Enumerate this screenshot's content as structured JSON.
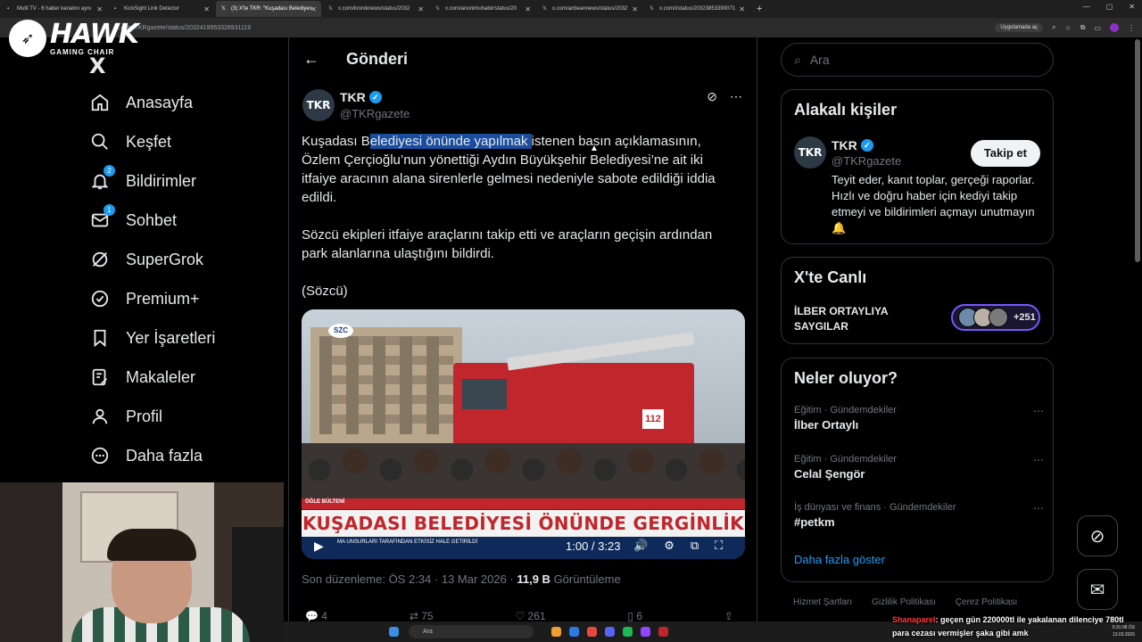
{
  "browser": {
    "tabs": [
      {
        "label": "Multi TV - 6 haber kanalını aynı",
        "active": false
      },
      {
        "label": "KickSight Link Detector",
        "active": false
      },
      {
        "label": "(3) X'te TKR: \"Kuşadası Belediyes",
        "active": true
      },
      {
        "label": "x.com/kroniknews/status/2032",
        "active": false
      },
      {
        "label": "x.com/anonimuhabir/status/20",
        "active": false
      },
      {
        "label": "x.com/anbeannews/status/2032",
        "active": false
      },
      {
        "label": "x.com/i/status/20323853390071",
        "active": false
      }
    ],
    "url": "x.com/TKRgazete/status/2032419953328931119",
    "app_pill": "Uygulamada aç"
  },
  "overlay": {
    "brand_big": "HAWK",
    "brand_small": "GAMING CHAIR",
    "chat_user": "Shanaparel",
    "chat_text": ": geçen gün 220000tl ile yakalanan dilenciye 780tl para cezası vermişler şaka gibi amk"
  },
  "taskbar": {
    "search_placeholder": "Ara",
    "time": "5:31:08 ÖS",
    "date": "13.03.2026"
  },
  "nav": {
    "logo": "X",
    "items": [
      {
        "label": "Anasayfa",
        "icon": "home-icon"
      },
      {
        "label": "Keşfet",
        "icon": "search-icon"
      },
      {
        "label": "Bildirimler",
        "icon": "bell-icon",
        "badge": "2"
      },
      {
        "label": "Sohbet",
        "icon": "mail-icon",
        "badge": "1"
      },
      {
        "label": "SuperGrok",
        "icon": "grok-icon"
      },
      {
        "label": "Premium+",
        "icon": "verified-icon"
      },
      {
        "label": "Yer İşaretleri",
        "icon": "bookmark-icon"
      },
      {
        "label": "Makaleler",
        "icon": "article-icon"
      },
      {
        "label": "Profil",
        "icon": "person-icon"
      },
      {
        "label": "Daha fazla",
        "icon": "more-circle-icon"
      }
    ]
  },
  "post": {
    "header": "Gönderi",
    "author_name": "TKR",
    "author_handle": "@TKRgazete",
    "avatar_text": "TKR",
    "text_p1_pre": "Kuşadası B",
    "text_p1_hl": "elediyesi önünde yapılmak ",
    "text_p1_post": "istenen basın açıklamasının, Özlem Çerçioğlu’nun yönettiği Aydın Büyükşehir Belediyesi’ne ait iki itfaiye aracının alana sirenlerle gelmesi nedeniyle sabote edildiği iddia edildi.",
    "text_p2": "Sözcü ekipleri itfaiye araçlarını takip etti ve araçların geçişin ardından park alanlarına ulaştığını bildirdi.",
    "text_p3": "(Sözcü)",
    "media": {
      "logo": "SZC",
      "truck_number": "112",
      "band_tag": "ÖĞLE BÜLTENİ",
      "headline": "KUŞADASI BELEDİYESİ ÖNÜNDE GERGİNLİK",
      "ticker": "MA UNSURLARI TARAFINDAN ETKİSİZ HALE GETİRİLDİ",
      "time": "1:00 / 3:23"
    },
    "meta_edit": "Son düzenleme: ÖS 2:34 · 13 Mar 2026 · ",
    "views_count": "11,9 B",
    "views_label": " Görüntüleme",
    "actions": {
      "replies": "4",
      "reposts": "75",
      "likes": "261",
      "bookmarks": "6"
    }
  },
  "right": {
    "search_placeholder": "Ara",
    "related_title": "Alakalı kişiler",
    "related": {
      "name": "TKR",
      "handle": "@TKRgazete",
      "avatar_text": "TKR",
      "follow": "Takip et",
      "bio": "Teyit eder, kanıt toplar, gerçeği raporlar. Hızlı ve doğru haber için kediyi takip etmeyi ve bildirimleri açmayı unutmayın🔔"
    },
    "live_title": "X'te Canlı",
    "live_label": "İLBER ORTAYLIYA SAYGILAR",
    "live_count": "+251",
    "trends_title": "Neler oluyor?",
    "trends": [
      {
        "category": "Eğitim · Gündemdekiler",
        "name": "İlber Ortaylı"
      },
      {
        "category": "Eğitim · Gündemdekiler",
        "name": "Celal Şengör"
      },
      {
        "category": "İş dünyası ve finans · Gündemdekiler",
        "name": "#petkm"
      }
    ],
    "show_more": "Daha fazla göster",
    "footer": [
      "Hizmet Şartları",
      "Gizlilik Politikası",
      "Çerez Politikası"
    ]
  },
  "colors": {
    "accent": "#1d9bf0",
    "background": "#000000",
    "border": "#2f3336",
    "muted": "#71767b"
  }
}
